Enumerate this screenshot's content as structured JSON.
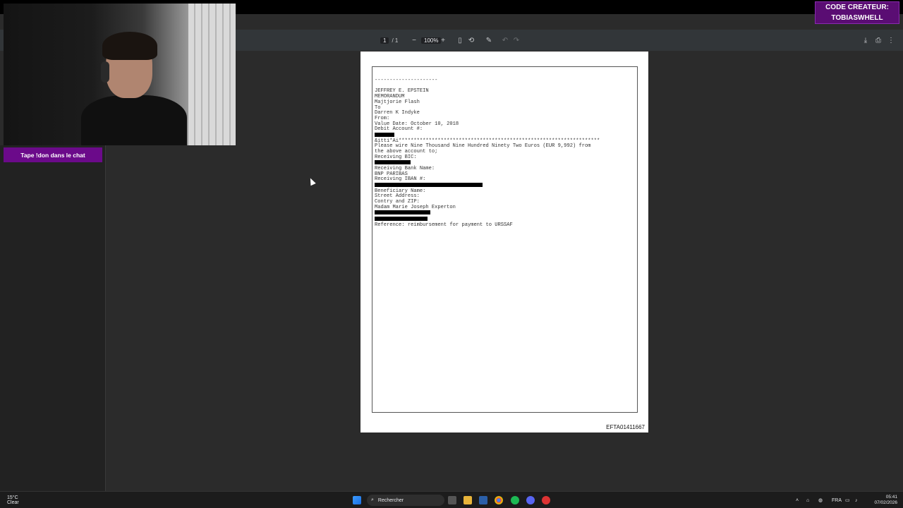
{
  "overlay": {
    "creator_line1": "CODE CREATEUR:",
    "creator_line2": "TOBIASWHELL",
    "donation_button": "Tape !don dans le chat"
  },
  "pdf_toolbar": {
    "page_current": "1",
    "page_sep": "/ 1",
    "zoom": "100%",
    "icons": [
      "minus-icon",
      "plus-icon",
      "fit-page-icon",
      "rotate-icon",
      "draw-icon",
      "undo-icon",
      "redo-icon",
      "download-icon",
      "print-icon",
      "more-icon"
    ]
  },
  "document": {
    "rule": "---------------------",
    "lines": [
      "JEFFREY E. EPSTEIN",
      "MEMORANDUM",
      "Majtjorie Flash",
      "To",
      "Darren K Indyke",
      "From:",
      "Value Date: October 10, 2018",
      "Debit Account #:"
    ],
    "stars_line": "&itti*Ai*******************************************************************",
    "lines2": [
      "Please wire Nine Thousand Nine Hundred Ninety Two Euros (EUR 9,992) from",
      "the above account to;",
      "Receiving BIC:"
    ],
    "lines3": [
      "Receiving Bank Name:",
      "BNP PARIBAS",
      "Receiving IBAN #:"
    ],
    "lines4": [
      "Beneficiary Name:",
      "Street Address:",
      "Contry and ZIP:",
      "Madam Marie Joseph Experton"
    ],
    "reference": "Reference: reimbursement for payment to URSSAF",
    "footer_id": "EFTA01411667"
  },
  "taskbar": {
    "weather_temp": "15°C",
    "weather_desc": "Clear",
    "search_placeholder": "Rechercher",
    "language": "FRA",
    "time": "05:41",
    "date": "07/02/2026"
  },
  "colors": {
    "accent_purple": "#6b0a8a",
    "viewer_bg": "#2b2b2b",
    "toolbar_bg": "#323639"
  }
}
